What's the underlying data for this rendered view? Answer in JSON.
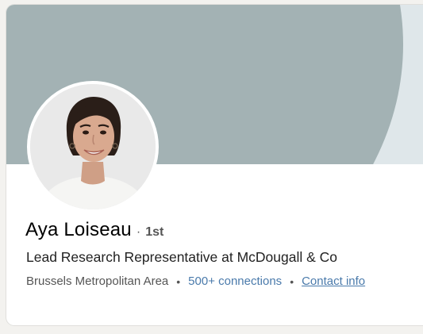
{
  "profile": {
    "name": "Aya Loiseau",
    "degree_separator": "·",
    "degree": "1st",
    "headline": "Lead Research Representative at McDougall & Co",
    "location": "Brussels Metropolitan Area",
    "connections": "500+ connections",
    "contact_info": "Contact info",
    "meta_separator": "•"
  },
  "colors": {
    "banner_shape": "#a3b2b4",
    "banner_background": "#dfe7ea",
    "link": "#4a7aab"
  }
}
